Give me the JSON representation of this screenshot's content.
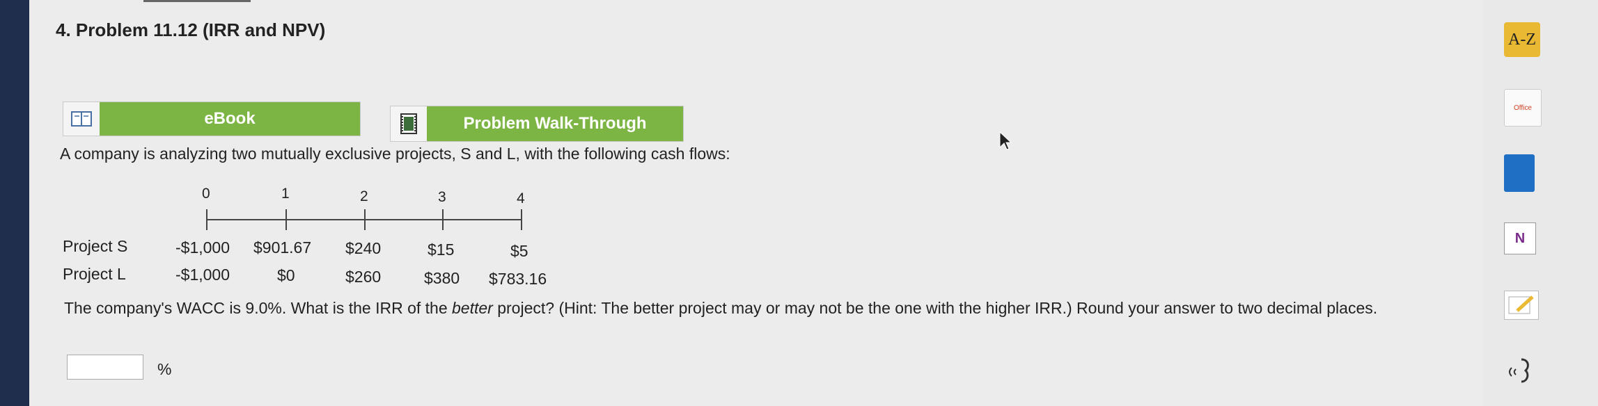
{
  "title": "4.  Problem 11.12 (IRR and NPV)",
  "buttons": {
    "ebook": "eBook",
    "walkthrough": "Problem Walk-Through"
  },
  "intro": "A company is analyzing two mutually exclusive projects, S and L, with the following cash flows:",
  "timeline": [
    "0",
    "1",
    "2",
    "3",
    "4"
  ],
  "projects": [
    {
      "label": "Project S",
      "flows": [
        "-$1,000",
        "$901.67",
        "$240",
        "$15",
        "$5"
      ]
    },
    {
      "label": "Project L",
      "flows": [
        "-$1,000",
        "$0",
        "$260",
        "$380",
        "$783.16"
      ]
    }
  ],
  "question": {
    "part1": "The company's WACC is 9.0%. What is the IRR of the ",
    "emph": "better",
    "part2": " project? (Hint: The better project may or may not be the one with the higher IRR.) Round your answer to two decimal places."
  },
  "answer": {
    "value": "",
    "unit": "%"
  },
  "sidebar": {
    "az_label": "A-Z",
    "office_label": "Office",
    "onenote_label": "N"
  }
}
